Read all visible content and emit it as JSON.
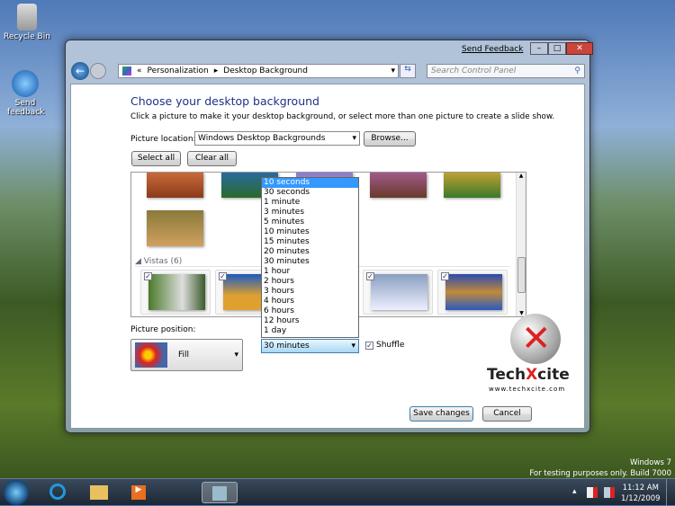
{
  "desktop": {
    "icons": [
      {
        "label": "Recycle Bin"
      },
      {
        "label": "Send feedback"
      }
    ],
    "watermark": {
      "line1": "Windows 7",
      "line2": "For testing purposes only. Build 7000"
    },
    "logo": {
      "text": "TechXcite",
      "url": "www.techxcite.com"
    }
  },
  "window": {
    "send_feedback": "Send Feedback",
    "breadcrumb": [
      "«",
      "Personalization",
      "Desktop Background"
    ],
    "search_placeholder": "Search Control Panel",
    "title": "Choose your desktop background",
    "subtitle": "Click a picture to make it your desktop background, or select more than one picture to create a slide show.",
    "picture_location_label": "Picture location:",
    "picture_location_value": "Windows Desktop Backgrounds",
    "browse": "Browse...",
    "select_all": "Select all",
    "clear_all": "Clear all",
    "group_label": "Vistas (6)",
    "picture_position_label": "Picture position:",
    "picture_position_value": "Fill",
    "interval_value": "30 minutes",
    "interval_options": [
      "10 seconds",
      "30 seconds",
      "1 minute",
      "3 minutes",
      "5 minutes",
      "10 minutes",
      "15 minutes",
      "20 minutes",
      "30 minutes",
      "1 hour",
      "2 hours",
      "3 hours",
      "4 hours",
      "6 hours",
      "12 hours",
      "1 day"
    ],
    "interval_highlighted": "10 seconds",
    "shuffle_label": "Shuffle",
    "shuffle_checked": true,
    "save": "Save changes",
    "cancel": "Cancel"
  },
  "taskbar": {
    "time": "11:12 AM",
    "date": "1/12/2009"
  },
  "colors": {
    "title": "#1e3287",
    "highlight": "#3399ff"
  }
}
